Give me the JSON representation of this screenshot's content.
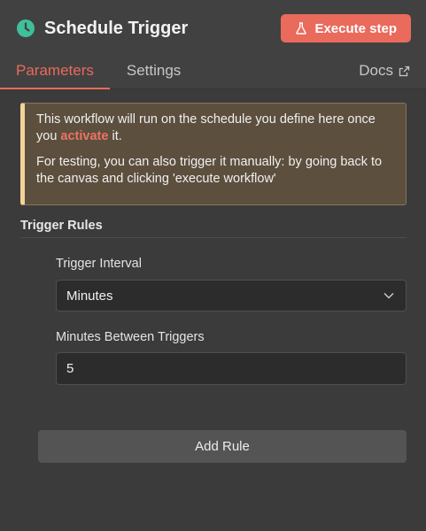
{
  "header": {
    "icon": "clock-icon",
    "title": "Schedule Trigger",
    "execute_icon": "flask-icon",
    "execute_label": "Execute step"
  },
  "tabs": {
    "items": [
      {
        "label": "Parameters",
        "active": true
      },
      {
        "label": "Settings",
        "active": false
      }
    ],
    "docs_label": "Docs",
    "docs_icon": "external-link-icon"
  },
  "notice": {
    "line1_before": "This workflow will run on the schedule you define here once you ",
    "line1_link": "activate",
    "line1_after": " it.",
    "line2": "For testing, you can also trigger it manually: by going back to the canvas and clicking 'execute workflow'"
  },
  "trigger_rules": {
    "section_title": "Trigger Rules",
    "interval_label": "Trigger Interval",
    "interval_value": "Minutes",
    "minutes_label": "Minutes Between Triggers",
    "minutes_value": "5",
    "add_rule_label": "Add Rule"
  },
  "colors": {
    "accent": "#ea6a5b",
    "clock": "#3fbf9b",
    "notice_bg": "#5c4f3e",
    "notice_border": "#f2d39a"
  }
}
